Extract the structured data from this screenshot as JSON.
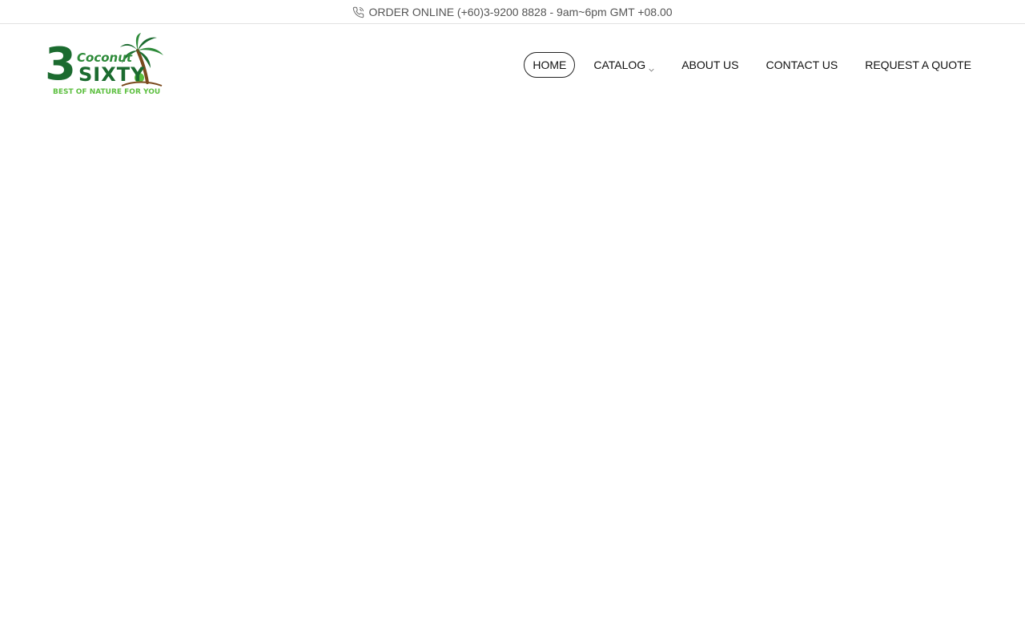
{
  "topbar": {
    "order_text": "ORDER ONLINE (+60)3-9200 8828 - 9am~6pm GMT +08.00",
    "icon": "phone-icon"
  },
  "logo": {
    "numeral": "3",
    "word_top": "Coconut",
    "word_main": "SIXTY",
    "tagline": "BEST OF NATURE FOR YOU",
    "colors": {
      "dark_green": "#1b6b2f",
      "light_green": "#5cbf3f",
      "trunk": "#7a4a1e"
    }
  },
  "nav": {
    "items": [
      {
        "label": "HOME",
        "active": true
      },
      {
        "label": "CATALOG",
        "active": false,
        "icon": "chevron-down-icon"
      },
      {
        "label": "ABOUT US",
        "active": false
      },
      {
        "label": "CONTACT US",
        "active": false
      },
      {
        "label": "REQUEST A QUOTE",
        "active": false
      }
    ]
  }
}
